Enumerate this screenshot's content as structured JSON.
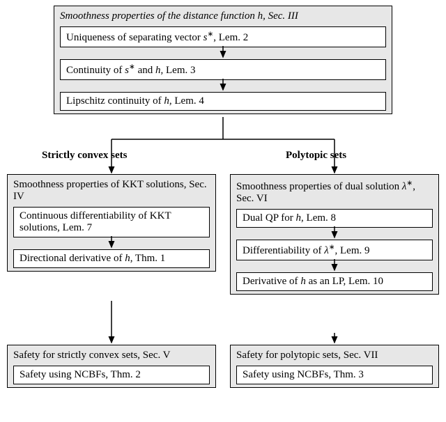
{
  "top": {
    "title_html": "Smoothness properties of the distance function <i>h</i>, Sec. III",
    "row1_html": "Uniqueness of separating vector <i>s</i><sup>∗</sup>, Lem. 2",
    "row2_html": "Continuity of <i>s</i><sup>∗</sup> and <i>h</i>, Lem. 3",
    "row3_html": "Lipschitz continuity of <i>h</i>, Lem. 4"
  },
  "labels": {
    "left": "Strictly convex sets",
    "right": "Polytopic sets"
  },
  "left": {
    "kkt_title_html": "Smoothness properties of KKT solutions, Sec. IV",
    "kkt_row1_html": "Continuous differentiability of KKT solutions, Lem. 7",
    "kkt_row2_html": "Directional derivative of <i>h</i>, Thm. 1",
    "safety_title_html": "Safety for strictly convex sets, Sec. V",
    "safety_row_html": "Safety using NCBFs, Thm. 2"
  },
  "right": {
    "dual_title_html": "Smoothness properties of dual solution <i>λ</i><sup>∗</sup>, Sec. VI",
    "dual_row1_html": "Dual QP for <i>h</i>, Lem. 8",
    "dual_row2_html": "Differentiability of <i>λ</i><sup>∗</sup>, Lem. 9",
    "dual_row3_html": "Derivative of <i>h</i> as an LP, Lem. 10",
    "safety_title_html": "Safety for polytopic sets, Sec. VII",
    "safety_row_html": "Safety using NCBFs, Thm. 3"
  },
  "chart_data": {
    "type": "diagram",
    "nodes": [
      {
        "id": "top",
        "label": "Smoothness properties of the distance function h, Sec. III",
        "children": [
          "lem2",
          "lem3",
          "lem4"
        ]
      },
      {
        "id": "lem2",
        "label": "Uniqueness of separating vector s*, Lem. 2"
      },
      {
        "id": "lem3",
        "label": "Continuity of s* and h, Lem. 3"
      },
      {
        "id": "lem4",
        "label": "Lipschitz continuity of h, Lem. 4"
      },
      {
        "id": "kkt",
        "label": "Smoothness properties of KKT solutions, Sec. IV",
        "children": [
          "lem7",
          "thm1"
        ],
        "branch": "Strictly convex sets"
      },
      {
        "id": "lem7",
        "label": "Continuous differentiability of KKT solutions, Lem. 7"
      },
      {
        "id": "thm1",
        "label": "Directional derivative of h, Thm. 1"
      },
      {
        "id": "sconv",
        "label": "Safety for strictly convex sets, Sec. V",
        "children": [
          "thm2"
        ]
      },
      {
        "id": "thm2",
        "label": "Safety using NCBFs, Thm. 2",
        "highlight": true
      },
      {
        "id": "dual",
        "label": "Smoothness properties of dual solution λ*, Sec. VI",
        "children": [
          "lem8",
          "lem9",
          "lem10"
        ],
        "branch": "Polytopic sets"
      },
      {
        "id": "lem8",
        "label": "Dual QP for h, Lem. 8"
      },
      {
        "id": "lem9",
        "label": "Differentiability of λ*, Lem. 9"
      },
      {
        "id": "lem10",
        "label": "Derivative of h as an LP, Lem. 10",
        "highlight": true
      },
      {
        "id": "poly",
        "label": "Safety for polytopic sets, Sec. VII",
        "children": [
          "thm3"
        ]
      },
      {
        "id": "thm3",
        "label": "Safety using NCBFs, Thm. 3",
        "highlight": true
      }
    ],
    "edges": [
      {
        "from": "lem2",
        "to": "lem3"
      },
      {
        "from": "lem3",
        "to": "lem4"
      },
      {
        "from": "top",
        "to": "kkt",
        "label": "Strictly convex sets"
      },
      {
        "from": "top",
        "to": "dual",
        "label": "Polytopic sets"
      },
      {
        "from": "lem7",
        "to": "thm1"
      },
      {
        "from": "kkt",
        "to": "sconv"
      },
      {
        "from": "lem8",
        "to": "lem9"
      },
      {
        "from": "lem9",
        "to": "lem10"
      },
      {
        "from": "dual",
        "to": "poly"
      }
    ]
  }
}
